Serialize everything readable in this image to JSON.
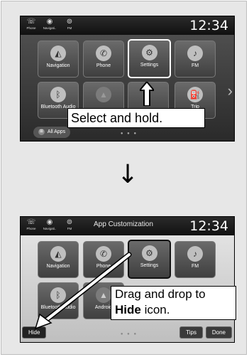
{
  "screen1": {
    "status_icons": [
      {
        "label": "Phone",
        "glyph": "☏"
      },
      {
        "label": "Navigati..",
        "glyph": "◉"
      },
      {
        "label": "FM",
        "glyph": "⊚"
      }
    ],
    "clock": "12:34",
    "tiles": [
      {
        "label": "Navigation",
        "icon": "navigation-icon",
        "glyph": "◭"
      },
      {
        "label": "Phone",
        "icon": "phone-icon",
        "glyph": "✆"
      },
      {
        "label": "Settings",
        "icon": "gear-icon",
        "glyph": "⚙"
      },
      {
        "label": "FM",
        "icon": "radio-icon",
        "glyph": "♪"
      },
      {
        "label": "Bluetooth Audio",
        "icon": "bluetooth-icon",
        "glyph": "ᛒ"
      },
      {
        "label": "",
        "icon": "android-icon",
        "glyph": "▲"
      },
      {
        "label": "",
        "icon": "blank-icon",
        "glyph": ""
      },
      {
        "label": "Trip",
        "icon": "fuel-icon",
        "glyph": "⛽"
      }
    ],
    "all_apps_label": "All Apps",
    "callout": "Select and hold."
  },
  "screen2": {
    "status_icons": [
      {
        "label": "Phone",
        "glyph": "☏"
      },
      {
        "label": "Navigati..",
        "glyph": "◉"
      },
      {
        "label": "FM",
        "glyph": "⊚"
      }
    ],
    "title": "App Customization",
    "clock": "12:34",
    "tiles": [
      {
        "label": "Navigation",
        "icon": "navigation-icon",
        "glyph": "◭"
      },
      {
        "label": "Phone",
        "icon": "phone-icon",
        "glyph": "✆"
      },
      {
        "label": "Settings",
        "icon": "gear-icon",
        "glyph": "⚙"
      },
      {
        "label": "FM",
        "icon": "radio-icon",
        "glyph": "♪"
      },
      {
        "label": "Bluetooth Audio",
        "icon": "bluetooth-icon",
        "glyph": "ᛒ"
      },
      {
        "label": "Android",
        "icon": "android-icon",
        "glyph": "▲"
      }
    ],
    "hide_label": "Hide",
    "tips_label": "Tips",
    "done_label": "Done",
    "callout_line1": "Drag and drop to",
    "callout_bold": "Hide",
    "callout_rest": " icon."
  },
  "colors": {
    "screen_bg": "#2a2a2a",
    "tile_bg": "#5a5a5a",
    "callout_bg": "#ffffff",
    "page_bg": "#e7e7e7"
  }
}
